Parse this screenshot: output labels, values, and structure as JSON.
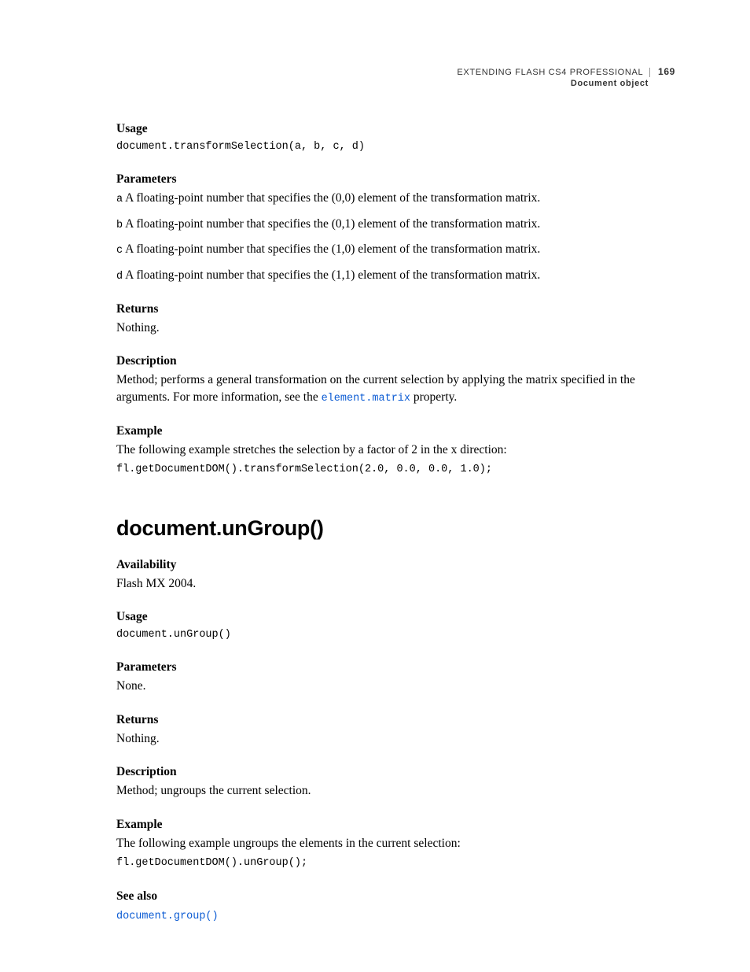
{
  "header": {
    "title": "EXTENDING FLASH CS4 PROFESSIONAL",
    "page_number": "169",
    "section": "Document object"
  },
  "section1": {
    "usage_label": "Usage",
    "usage_code": "document.transformSelection(a, b, c, d)",
    "params_label": "Parameters",
    "params": {
      "a": {
        "name": "a",
        "desc": " A floating-point number that specifies the (0,0) element of the transformation matrix."
      },
      "b": {
        "name": "b",
        "desc": " A floating-point number that specifies the (0,1) element of the transformation matrix."
      },
      "c": {
        "name": "c",
        "desc": " A floating-point number that specifies the (1,0) element of the transformation matrix."
      },
      "d": {
        "name": "d",
        "desc": " A floating-point number that specifies the (1,1) element of the transformation matrix."
      }
    },
    "returns_label": "Returns",
    "returns_text": "Nothing.",
    "desc_label": "Description",
    "desc_text_pre": "Method; performs a general transformation on the current selection by applying the matrix specified in the arguments. For more information, see the ",
    "desc_link": "element.matrix",
    "desc_text_post": " property.",
    "example_label": "Example",
    "example_text": "The following example stretches the selection by a factor of 2 in the x direction:",
    "example_code": "fl.getDocumentDOM().transformSelection(2.0, 0.0, 0.0, 1.0);"
  },
  "section2": {
    "heading": "document.unGroup()",
    "avail_label": "Availability",
    "avail_text": "Flash MX 2004.",
    "usage_label": "Usage",
    "usage_code": "document.unGroup()",
    "params_label": "Parameters",
    "params_text": "None.",
    "returns_label": "Returns",
    "returns_text": "Nothing.",
    "desc_label": "Description",
    "desc_text": "Method; ungroups the current selection.",
    "example_label": "Example",
    "example_text": "The following example ungroups the elements in the current selection:",
    "example_code": "fl.getDocumentDOM().unGroup();",
    "seealso_label": "See also",
    "seealso_link": "document.group()"
  }
}
